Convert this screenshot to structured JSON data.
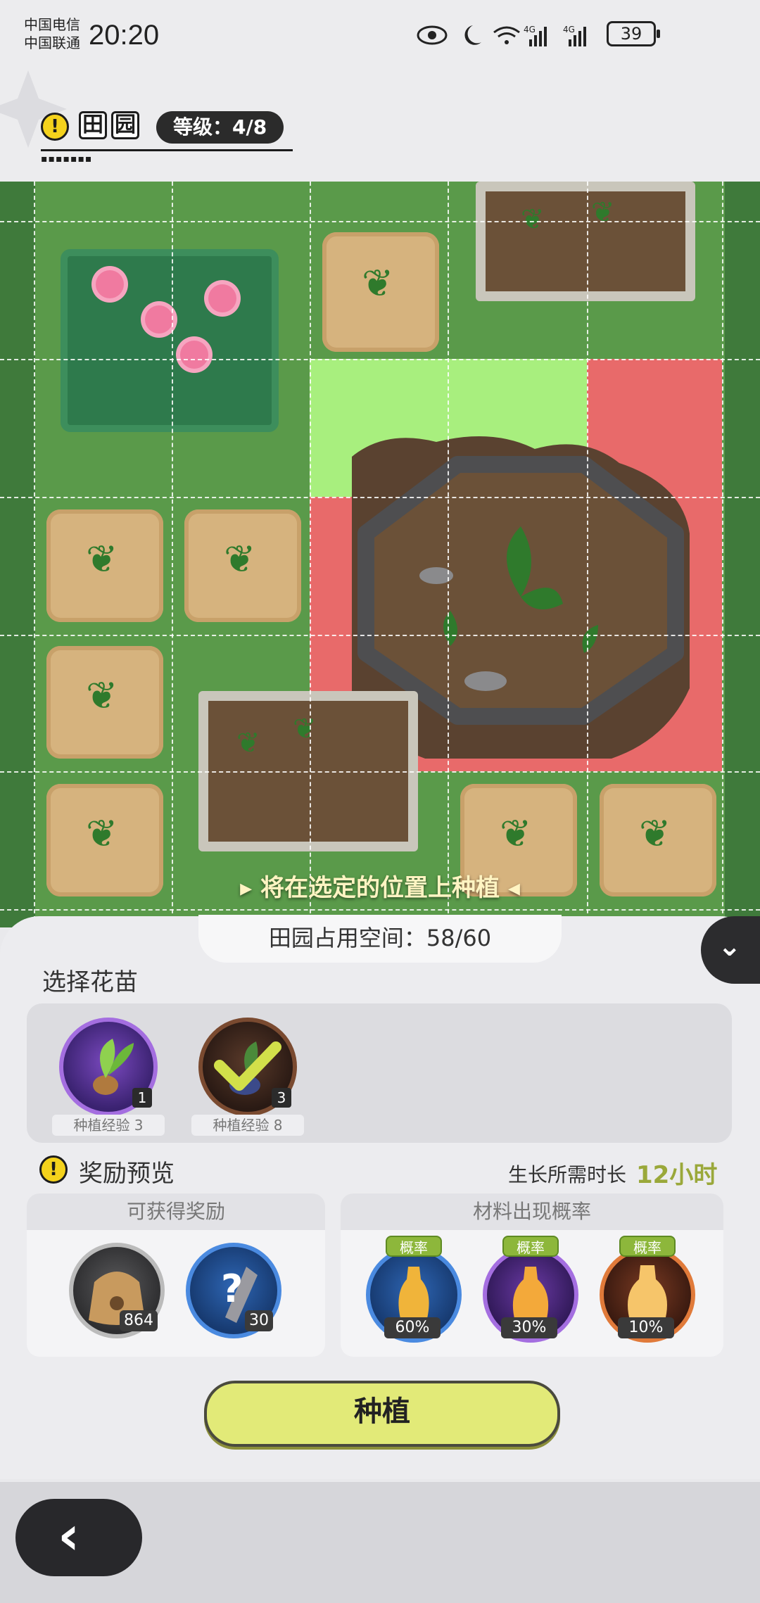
{
  "status_bar": {
    "carrier_1": "中国电信",
    "carrier_2": "中国联通",
    "time": "20:20",
    "battery": "39",
    "icons": [
      "eye-icon",
      "moon-icon",
      "wifi-icon",
      "signal-4g-icon",
      "signal-4g-icon"
    ]
  },
  "header": {
    "title_chars": [
      "田",
      "园"
    ],
    "level_label": "等级：4/8"
  },
  "garden": {
    "hint": "将在选定的位置上种植"
  },
  "panel": {
    "space_label": "田园占用空间：58/60",
    "seed_section_title": "选择花苗",
    "seeds": [
      {
        "count": "1",
        "exp_label": "种植经验 3",
        "selected": false
      },
      {
        "count": "3",
        "exp_label": "种植经验 8",
        "selected": true
      }
    ],
    "reward_title": "奖励预览",
    "growth_label": "生长所需时长",
    "growth_value": "12小时",
    "rewards_header": "可获得奖励",
    "rewards": [
      {
        "icon": "seed-bag-icon",
        "count": "864"
      },
      {
        "icon": "mystery-item-icon",
        "count": "30"
      }
    ],
    "materials_header": "材料出现概率",
    "materials": [
      {
        "icon": "essence-bottle-icon",
        "tag": "概率",
        "rate": "60%"
      },
      {
        "icon": "essence-bottle-icon",
        "tag": "概率",
        "rate": "30%"
      },
      {
        "icon": "essence-bottle-icon",
        "tag": "概率",
        "rate": "10%"
      }
    ],
    "plant_button": "种植"
  },
  "colors": {
    "accent_green": "#8db73b",
    "button_yellow": "#e2ea78",
    "growth_value": "#9aa83a"
  }
}
